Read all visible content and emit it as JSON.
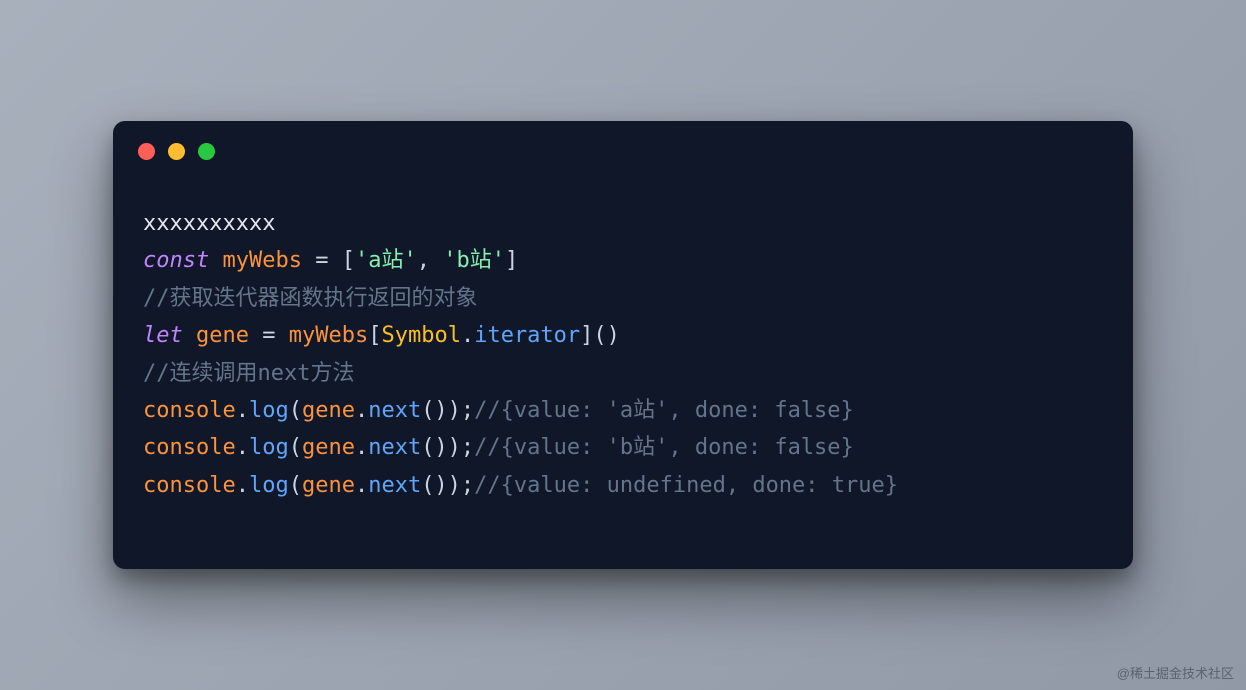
{
  "code": {
    "lines": [
      {
        "tokens": [
          {
            "t": "plain",
            "v": "xxxxxxxxxx"
          }
        ]
      },
      {
        "tokens": [
          {
            "t": "keyword",
            "v": "const"
          },
          {
            "t": "plain",
            "v": " "
          },
          {
            "t": "ident",
            "v": "myWebs"
          },
          {
            "t": "plain",
            "v": " "
          },
          {
            "t": "punct",
            "v": "="
          },
          {
            "t": "plain",
            "v": " "
          },
          {
            "t": "punct",
            "v": "["
          },
          {
            "t": "string",
            "v": "'a站'"
          },
          {
            "t": "punct",
            "v": ","
          },
          {
            "t": "plain",
            "v": " "
          },
          {
            "t": "string",
            "v": "'b站'"
          },
          {
            "t": "punct",
            "v": "]"
          }
        ]
      },
      {
        "tokens": [
          {
            "t": "comment",
            "v": "//获取迭代器函数执行返回的对象"
          }
        ]
      },
      {
        "tokens": [
          {
            "t": "keyword",
            "v": "let"
          },
          {
            "t": "plain",
            "v": " "
          },
          {
            "t": "ident",
            "v": "gene"
          },
          {
            "t": "plain",
            "v": " "
          },
          {
            "t": "punct",
            "v": "="
          },
          {
            "t": "plain",
            "v": " "
          },
          {
            "t": "ident",
            "v": "myWebs"
          },
          {
            "t": "punct",
            "v": "["
          },
          {
            "t": "builtin",
            "v": "Symbol"
          },
          {
            "t": "punct",
            "v": "."
          },
          {
            "t": "method",
            "v": "iterator"
          },
          {
            "t": "punct",
            "v": "]()"
          }
        ]
      },
      {
        "tokens": [
          {
            "t": "comment",
            "v": "//连续调用next方法"
          }
        ]
      },
      {
        "tokens": [
          {
            "t": "ident",
            "v": "console"
          },
          {
            "t": "punct",
            "v": "."
          },
          {
            "t": "method",
            "v": "log"
          },
          {
            "t": "punct",
            "v": "("
          },
          {
            "t": "ident",
            "v": "gene"
          },
          {
            "t": "punct",
            "v": "."
          },
          {
            "t": "method",
            "v": "next"
          },
          {
            "t": "punct",
            "v": "());"
          },
          {
            "t": "comment",
            "v": "//{value: 'a站', done: false}"
          }
        ]
      },
      {
        "tokens": [
          {
            "t": "ident",
            "v": "console"
          },
          {
            "t": "punct",
            "v": "."
          },
          {
            "t": "method",
            "v": "log"
          },
          {
            "t": "punct",
            "v": "("
          },
          {
            "t": "ident",
            "v": "gene"
          },
          {
            "t": "punct",
            "v": "."
          },
          {
            "t": "method",
            "v": "next"
          },
          {
            "t": "punct",
            "v": "());"
          },
          {
            "t": "comment",
            "v": "//{value: 'b站', done: false}"
          }
        ]
      },
      {
        "tokens": [
          {
            "t": "ident",
            "v": "console"
          },
          {
            "t": "punct",
            "v": "."
          },
          {
            "t": "method",
            "v": "log"
          },
          {
            "t": "punct",
            "v": "("
          },
          {
            "t": "ident",
            "v": "gene"
          },
          {
            "t": "punct",
            "v": "."
          },
          {
            "t": "method",
            "v": "next"
          },
          {
            "t": "punct",
            "v": "());"
          },
          {
            "t": "comment",
            "v": "//{value: undefined, done: true}"
          }
        ]
      }
    ]
  },
  "watermark": "@稀土掘金技术社区"
}
